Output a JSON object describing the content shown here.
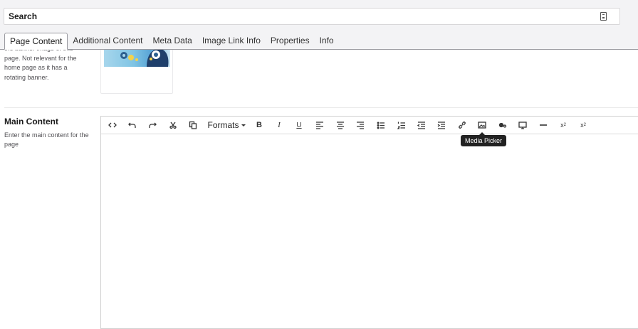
{
  "search": {
    "label": "Search",
    "icon": "document-icon"
  },
  "tabs": [
    {
      "label": "Page Content",
      "active": true
    },
    {
      "label": "Additional Content"
    },
    {
      "label": "Meta Data"
    },
    {
      "label": "Image Link Info"
    },
    {
      "label": "Properties"
    },
    {
      "label": "Info"
    }
  ],
  "banner": {
    "description": "the banner image of this page. Not relevant for the home page as it has a rotating banner."
  },
  "main_content": {
    "label": "Main Content",
    "description": "Enter the main content for the page"
  },
  "toolbar": {
    "formats_label": "Formats",
    "buttons": [
      "source-code",
      "undo",
      "redo",
      "cut",
      "copy",
      "formats",
      "bold",
      "italic",
      "underline",
      "align-left",
      "align-center",
      "align-right",
      "bullet-list",
      "numbered-list",
      "outdent",
      "indent",
      "link",
      "media-picker",
      "macro",
      "embed",
      "horizontal-rule",
      "subscript",
      "superscript"
    ]
  },
  "tooltip": {
    "text": "Media Picker"
  }
}
